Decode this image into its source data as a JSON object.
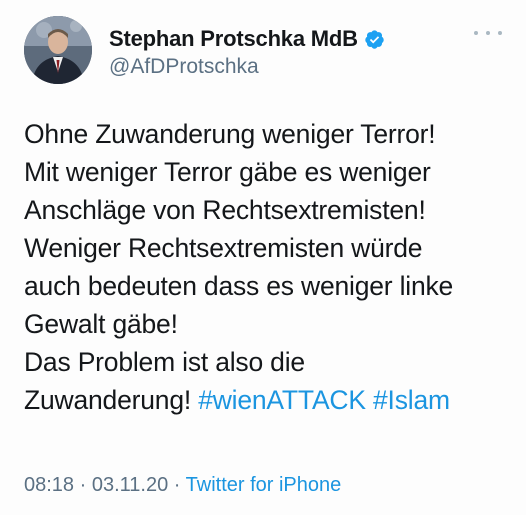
{
  "author": {
    "display_name": "Stephan Protschka MdB",
    "handle": "@AfDProtschka",
    "verified": true
  },
  "tweet": {
    "lines": [
      "Ohne Zuwanderung weniger Terror!",
      "Mit weniger Terror gäbe es weniger",
      "Anschläge von Rechtsextremisten!",
      "Weniger Rechtsextremisten würde",
      "auch bedeuten dass es weniger linke",
      "Gewalt gäbe!",
      "Das Problem ist also die"
    ],
    "last_line_text": "Zuwanderung! ",
    "hashtags": [
      "#wienATTACK",
      "#Islam"
    ]
  },
  "meta": {
    "time": "08:18",
    "separator": " · ",
    "date": "03.11.20",
    "source": "Twitter for iPhone"
  },
  "icons": {
    "verified": "verified-badge-icon",
    "more": "more-options-icon"
  },
  "colors": {
    "link": "#1b95e0",
    "secondary_text": "#5b7083",
    "primary_text": "#14171a",
    "verified": "#1da1f2"
  }
}
